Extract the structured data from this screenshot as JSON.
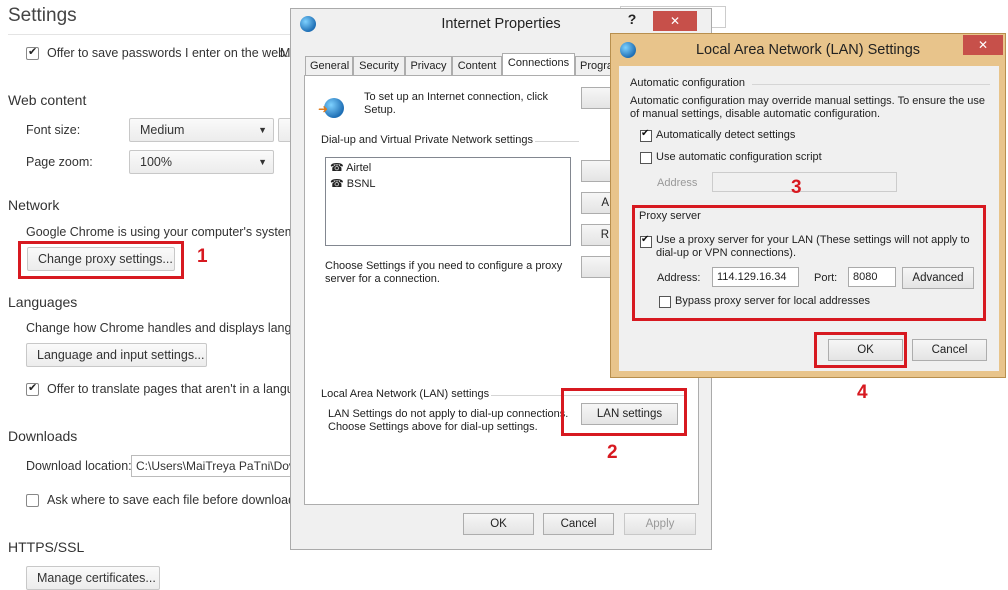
{
  "chrome": {
    "title": "Settings",
    "save_passwords": "Offer to save passwords I enter on the web.",
    "save_passwords_tail": "M",
    "web_content": "Web content",
    "font_size_label": "Font size:",
    "font_size_value": "Medium",
    "page_zoom_label": "Page zoom:",
    "page_zoom_value": "100%",
    "network": "Network",
    "network_desc": "Google Chrome is using your computer's system p",
    "change_proxy": "Change proxy settings...",
    "languages": "Languages",
    "languages_desc": "Change how Chrome handles and displays langua",
    "lang_input": "Language and input settings...",
    "translate": "Offer to translate pages that aren't in a langua",
    "downloads": "Downloads",
    "download_location_label": "Download location:",
    "download_location_value": "C:\\Users\\MaiTreya PaTni\\Dov",
    "ask_where": "Ask where to save each file before downloadir",
    "https": "HTTPS/SSL",
    "manage_certs": "Manage certificates..."
  },
  "inet": {
    "title": "Internet Properties",
    "help": "?",
    "close": "✕",
    "tabs": [
      "General",
      "Security",
      "Privacy",
      "Content",
      "Connections",
      "Progra"
    ],
    "setup_text": "To set up an Internet connection, click Setup.",
    "dialup_group": "Dial-up and Virtual Private Network settings",
    "connections": [
      "Airtel",
      "BSNL"
    ],
    "btn_a": "A",
    "btn_r": "R",
    "choose_text": "Choose Settings if you need to configure a proxy server for a connection.",
    "lan_group": "Local Area Network (LAN) settings",
    "lan_text1": "LAN Settings do not apply to dial-up connections.",
    "lan_text2": "Choose Settings above for dial-up settings.",
    "lan_button": "LAN settings",
    "ok": "OK",
    "cancel": "Cancel",
    "apply": "Apply"
  },
  "lan": {
    "title": "Local Area Network (LAN) Settings",
    "close": "✕",
    "auto_group": "Automatic configuration",
    "auto_desc": "Automatic configuration may override manual settings.  To ensure the use of manual settings, disable automatic configuration.",
    "auto_detect": "Automatically detect settings",
    "use_script": "Use automatic configuration script",
    "address_label": "Address",
    "proxy_group": "Proxy server",
    "use_proxy": "Use a proxy server for your LAN (These settings will not apply to dial-up or VPN connections).",
    "proxy_address_label": "Address:",
    "proxy_address": "114.129.16.34",
    "port_label": "Port:",
    "port": "8080",
    "advanced": "Advanced",
    "bypass": "Bypass proxy server for local addresses",
    "ok": "OK",
    "cancel": "Cancel"
  },
  "steps": [
    "1",
    "2",
    "3",
    "4"
  ],
  "colors": {
    "highlight": "#d71920",
    "close": "#c7504a"
  }
}
